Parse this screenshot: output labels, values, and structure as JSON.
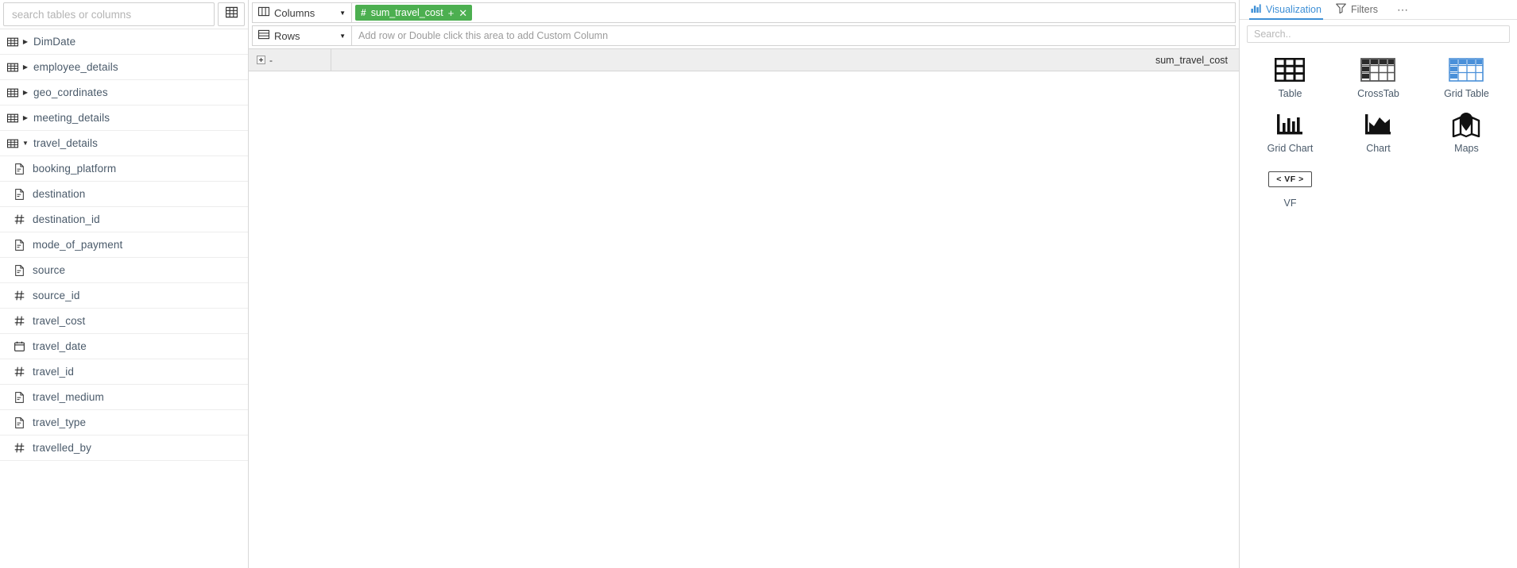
{
  "sidebar": {
    "search": {
      "placeholder": "search tables or columns",
      "value": ""
    },
    "grid_button": {
      "icon": "grid-icon"
    },
    "tables": [
      {
        "name": "DimDate",
        "icon": "table-icon",
        "expanded": false
      },
      {
        "name": "employee_details",
        "icon": "table-icon",
        "expanded": false
      },
      {
        "name": "geo_cordinates",
        "icon": "table-icon",
        "expanded": false
      },
      {
        "name": "meeting_details",
        "icon": "table-icon",
        "expanded": false
      },
      {
        "name": "travel_details",
        "icon": "table-icon",
        "expanded": true
      }
    ],
    "columns": [
      {
        "name": "booking_platform",
        "type": "text",
        "icon": "document-icon"
      },
      {
        "name": "destination",
        "type": "text",
        "icon": "document-icon"
      },
      {
        "name": "destination_id",
        "type": "number",
        "icon": "hash-icon"
      },
      {
        "name": "mode_of_payment",
        "type": "text",
        "icon": "document-icon"
      },
      {
        "name": "source",
        "type": "text",
        "icon": "document-icon"
      },
      {
        "name": "source_id",
        "type": "number",
        "icon": "hash-icon"
      },
      {
        "name": "travel_cost",
        "type": "number",
        "icon": "hash-icon"
      },
      {
        "name": "travel_date",
        "type": "date",
        "icon": "calendar-icon"
      },
      {
        "name": "travel_id",
        "type": "number",
        "icon": "hash-icon"
      },
      {
        "name": "travel_medium",
        "type": "text",
        "icon": "document-icon"
      },
      {
        "name": "travel_type",
        "type": "text",
        "icon": "document-icon"
      },
      {
        "name": "travelled_by",
        "type": "number",
        "icon": "hash-icon"
      }
    ]
  },
  "shelves": {
    "columns": {
      "label": "Columns",
      "icon": "columns-icon",
      "chips": [
        {
          "label": "sum_travel_cost",
          "icon": "hash-icon",
          "color": "#4caf50",
          "plus": "+",
          "close": "✕"
        }
      ]
    },
    "rows": {
      "label": "Rows",
      "icon": "rows-icon",
      "chips": [],
      "placeholder": "Add row or Double click this area to add Custom Column"
    }
  },
  "table": {
    "corner": {
      "expand_icon": "expand-box-icon",
      "dash": "-"
    },
    "measure_header": "sum_travel_cost",
    "rows": []
  },
  "right_panel": {
    "tabs": [
      {
        "label": "Visualization",
        "icon": "chart-bar-icon",
        "active": true
      },
      {
        "label": "Filters",
        "icon": "funnel-icon",
        "active": false
      }
    ],
    "more_menu": "⋯",
    "search": {
      "placeholder": "Search..",
      "value": ""
    },
    "viz_types": [
      {
        "label": "Table",
        "icon": "table-grid-icon"
      },
      {
        "label": "CrossTab",
        "icon": "crosstab-icon"
      },
      {
        "label": "Grid Table",
        "icon": "grid-table-icon"
      },
      {
        "label": "Grid Chart",
        "icon": "bar-chart-icon"
      },
      {
        "label": "Chart",
        "icon": "area-chart-icon"
      },
      {
        "label": "Maps",
        "icon": "map-pin-icon"
      },
      {
        "label": "VF",
        "icon": "vf-icon",
        "icon_text": "< VF >"
      }
    ]
  },
  "colors": {
    "accent_blue": "#3d8fd6",
    "chip_green": "#4caf50",
    "grid_table_blue": "#4a90d9",
    "border": "#d8d8d8",
    "header_grey": "#eeeeee"
  }
}
